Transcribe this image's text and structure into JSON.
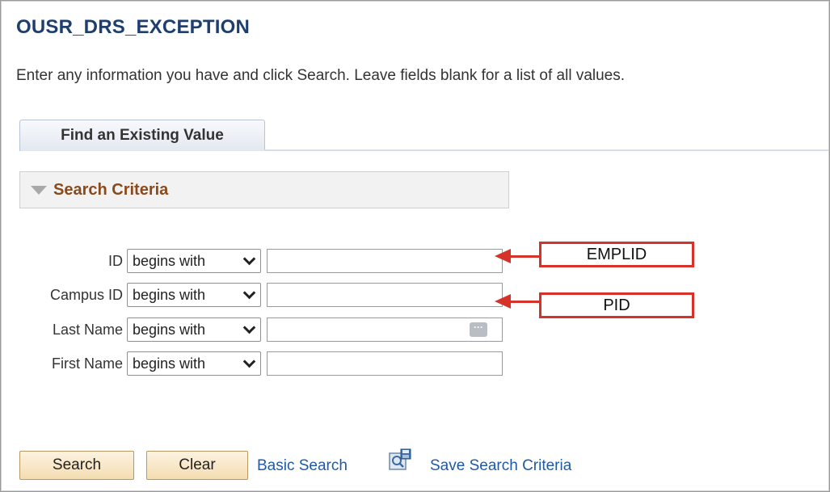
{
  "page": {
    "title": "OUSR_DRS_EXCEPTION",
    "instructions": "Enter any information you have and click Search. Leave fields blank for a list of all values."
  },
  "tabs": [
    {
      "label": "Find an Existing Value"
    }
  ],
  "search_criteria": {
    "header": "Search Criteria",
    "fields": [
      {
        "label": "ID",
        "operator": "begins with",
        "value": ""
      },
      {
        "label": "Campus ID",
        "operator": "begins with",
        "value": ""
      },
      {
        "label": "Last Name",
        "operator": "begins with",
        "value": "",
        "prompt_icon": "ellipsis-icon",
        "prompt_glyph": "···"
      },
      {
        "label": "First Name",
        "operator": "begins with",
        "value": ""
      }
    ]
  },
  "annotations": [
    {
      "text": "EMPLID",
      "color": "#d7322a"
    },
    {
      "text": "PID",
      "color": "#d7322a"
    }
  ],
  "actions": {
    "search_label": "Search",
    "clear_label": "Clear",
    "basic_search_label": "Basic Search",
    "save_search_label": "Save Search Criteria",
    "save_icon": "save-search-icon"
  },
  "colors": {
    "title": "#1e3f6e",
    "group_title": "#8a4a1c",
    "link": "#1f5aa6",
    "button_bg": "#f4dcb0",
    "annotation": "#d7322a"
  }
}
